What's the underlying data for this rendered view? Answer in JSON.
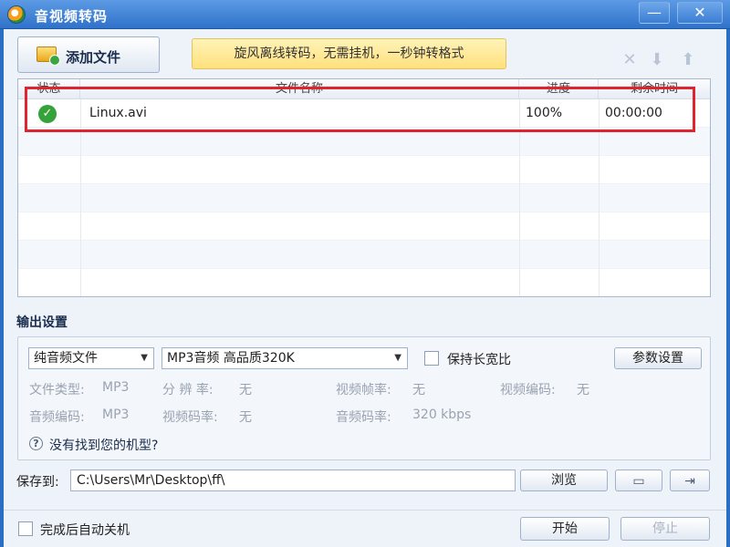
{
  "window": {
    "title": "音视频转码",
    "minimize_label": "—",
    "close_label": "✕"
  },
  "toolbar": {
    "add_file_label": "添加文件",
    "promo_text": "旋风离线转码，无需挂机，一秒钟转格式"
  },
  "file_list": {
    "columns": [
      "状态",
      "文件名称",
      "进度",
      "剩余时间"
    ],
    "rows": [
      {
        "status": "done",
        "name": "Linux.avi",
        "progress": "100%",
        "remaining": "00:00:00"
      }
    ]
  },
  "output": {
    "section_title": "输出设置",
    "format_type": "纯音频文件",
    "preset": "MP3音频 高品质320K",
    "keep_ratio_label": "保持长宽比",
    "keep_ratio_checked": false,
    "params_button": "参数设置",
    "file_type_label": "文件类型:",
    "file_type_value": "MP3",
    "resolution_label": "分 辨 率:",
    "resolution_value": "无",
    "frame_rate_label": "视频帧率:",
    "frame_rate_value": "无",
    "video_codec_label": "视频编码:",
    "video_codec_value": "无",
    "audio_codec_label": "音频编码:",
    "audio_codec_value": "MP3",
    "video_bitrate_label": "视频码率:",
    "video_bitrate_value": "无",
    "audio_bitrate_label": "音频码率:",
    "audio_bitrate_value": "320 kbps",
    "help_text": "没有找到您的机型?"
  },
  "save": {
    "label": "保存到:",
    "path": "C:\\Users\\Mr\\Desktop\\ff\\",
    "browse_label": "浏览"
  },
  "footer": {
    "shutdown_label": "完成后自动关机",
    "start_label": "开始",
    "stop_label": "停止"
  },
  "colors": {
    "accent": "#2f72c9",
    "success": "#36a33a",
    "highlight": "#e0242d"
  }
}
